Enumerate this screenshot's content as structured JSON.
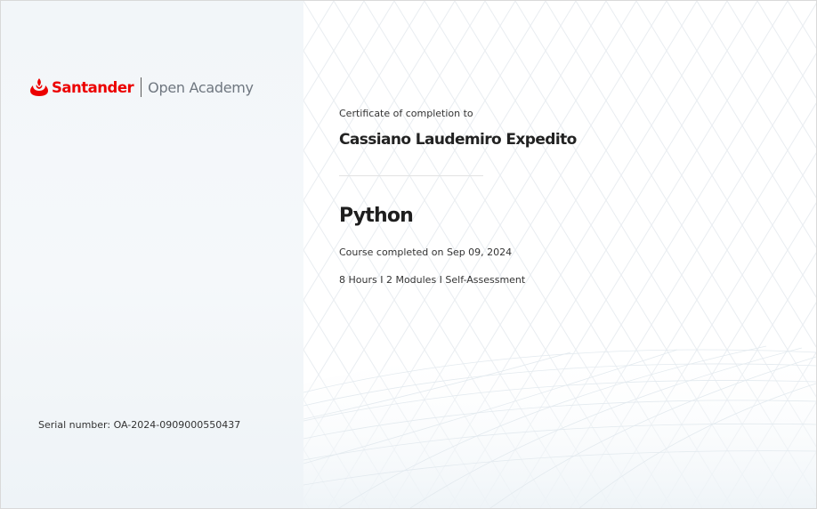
{
  "logo": {
    "brand": "Santander",
    "product": "Open Academy",
    "brand_color": "#ec0000",
    "icon": "santander-flame-icon"
  },
  "certificate": {
    "caption": "Certificate of completion to",
    "recipient": "Cassiano Laudemiro Expedito",
    "course": "Python",
    "completed": "Course completed on Sep 09, 2024",
    "details": "8 Hours I 2 Modules I Self-Assessment",
    "serial": "Serial number: OA-2024-0909000550437"
  },
  "colors": {
    "left_panel": "#f2f6f9",
    "text": "#333333",
    "pattern": "#e6ebf0"
  }
}
